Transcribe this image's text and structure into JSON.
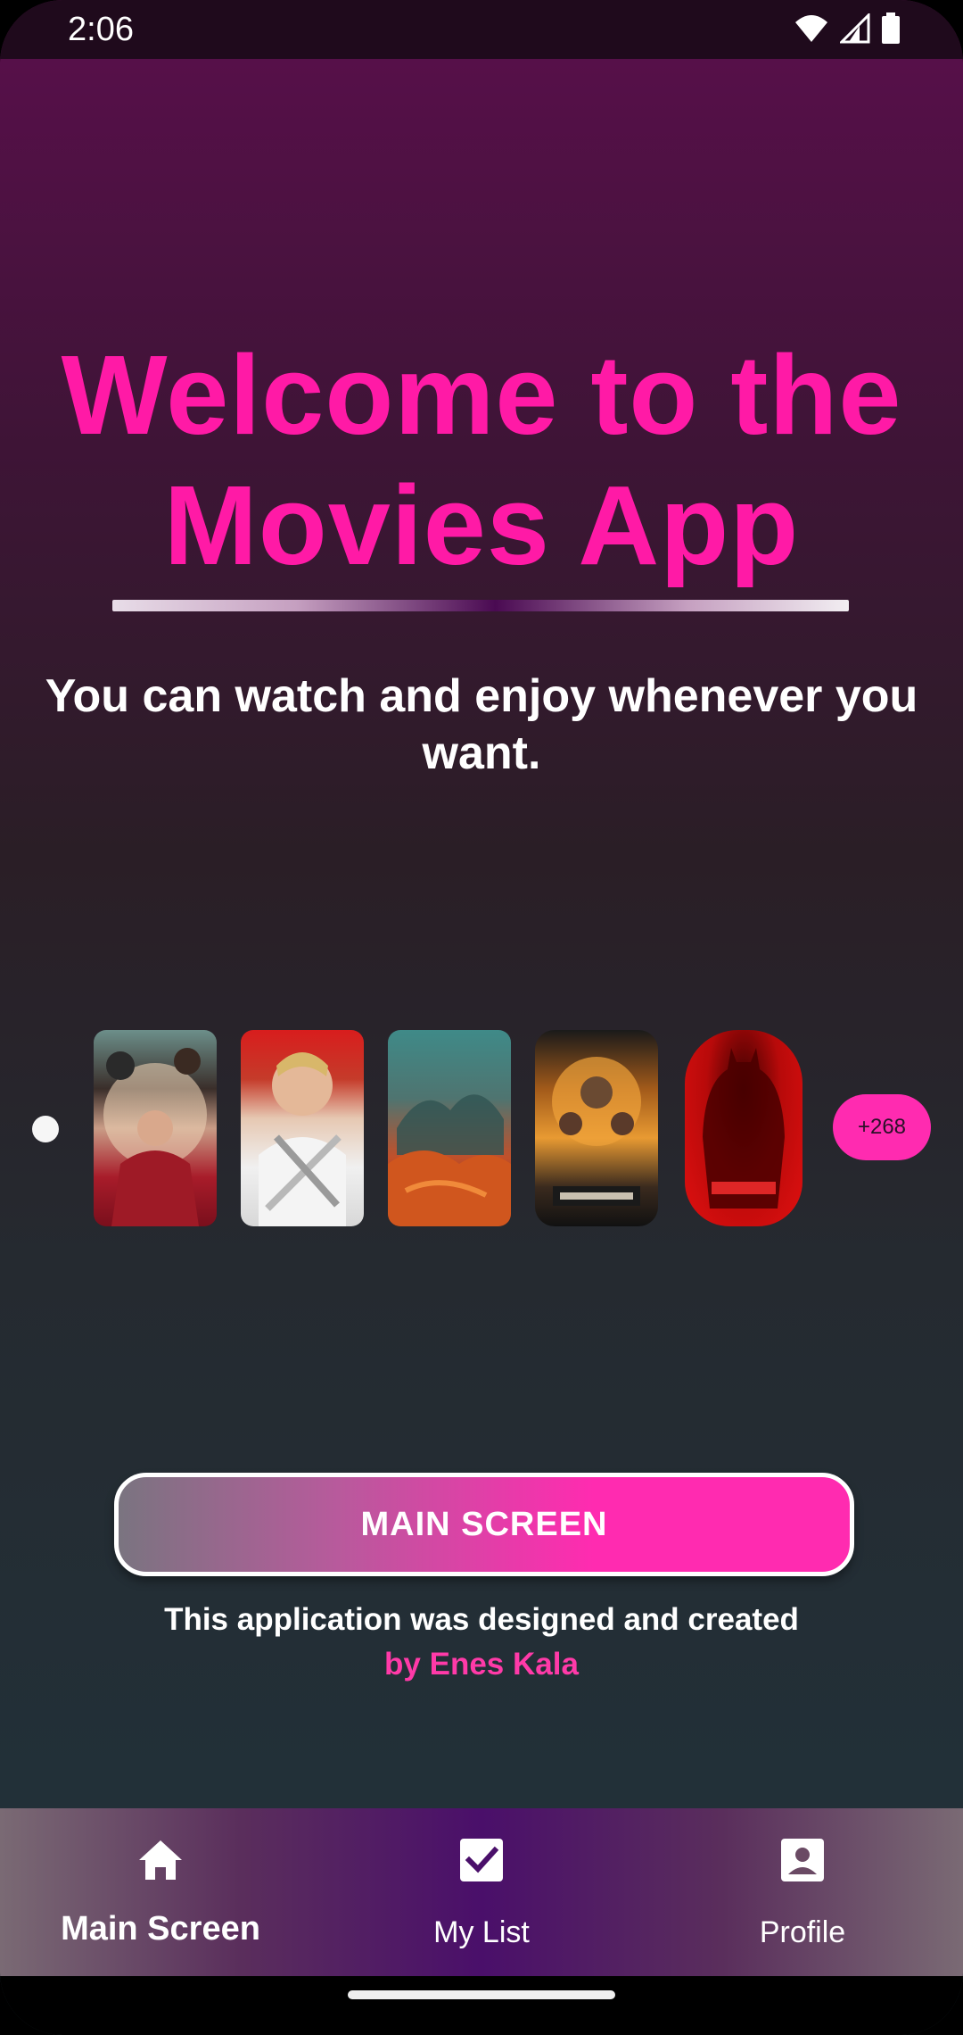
{
  "status_bar": {
    "time": "2:06",
    "icons": [
      "wifi-icon",
      "signal-icon",
      "battery-icon"
    ]
  },
  "welcome": {
    "title_line1": "Welcome to the",
    "title_line2": "Movies App",
    "subtitle": "You can watch and enjoy whenever you want."
  },
  "posters": {
    "more_count": "+268",
    "items": [
      "poster-1",
      "poster-2",
      "poster-3",
      "poster-4",
      "poster-5"
    ]
  },
  "main_button": {
    "label": "MAIN SCREEN"
  },
  "credits": {
    "line1": "This application was designed and created",
    "line2": "by Enes Kala"
  },
  "bottom_nav": {
    "items": [
      {
        "label": "Main Screen",
        "icon": "home-icon",
        "active": true
      },
      {
        "label": "My List",
        "icon": "checkbox-icon",
        "active": false
      },
      {
        "label": "Profile",
        "icon": "profile-icon",
        "active": false
      }
    ]
  },
  "colors": {
    "accent": "#ff1aa6",
    "button_pink": "#ff2bb0",
    "credit_pink": "#ff3aa8"
  }
}
